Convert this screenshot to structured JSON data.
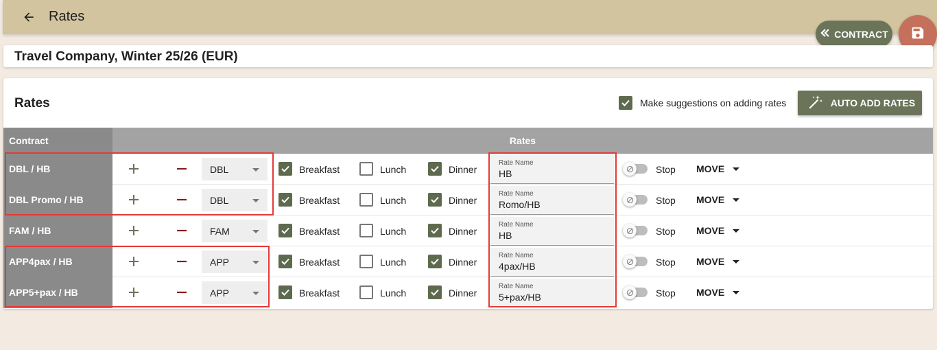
{
  "topbar": {
    "title": "Rates"
  },
  "actions": {
    "contract_label": "CONTRACT"
  },
  "header": {
    "title": "Travel Company, Winter 25/26 (EUR)"
  },
  "rates_section": {
    "title": "Rates",
    "suggestions_label": "Make suggestions on adding rates",
    "suggestions_checked": true,
    "auto_add_label": "AUTO ADD RATES",
    "col_contract": "Contract",
    "col_rates": "Rates"
  },
  "meals": {
    "breakfast": "Breakfast",
    "lunch": "Lunch",
    "dinner": "Dinner"
  },
  "rows": [
    {
      "contract": "DBL / HB",
      "room_type": "DBL",
      "breakfast": true,
      "lunch": false,
      "dinner": true,
      "rate_name_label": "Rate Name",
      "rate_name": "HB",
      "stop_label": "Stop",
      "stop": false,
      "move_label": "MOVE"
    },
    {
      "contract": "DBL Promo / HB",
      "room_type": "DBL",
      "breakfast": true,
      "lunch": false,
      "dinner": true,
      "rate_name_label": "Rate Name",
      "rate_name": "Romo/HB",
      "stop_label": "Stop",
      "stop": false,
      "move_label": "MOVE"
    },
    {
      "contract": "FAM / HB",
      "room_type": "FAM",
      "breakfast": true,
      "lunch": false,
      "dinner": true,
      "rate_name_label": "Rate Name",
      "rate_name": "HB",
      "stop_label": "Stop",
      "stop": false,
      "move_label": "MOVE"
    },
    {
      "contract": "APP4pax / HB",
      "room_type": "APP",
      "breakfast": true,
      "lunch": false,
      "dinner": true,
      "rate_name_label": "Rate Name",
      "rate_name": "4pax/HB",
      "stop_label": "Stop",
      "stop": false,
      "move_label": "MOVE"
    },
    {
      "contract": "APP5+pax / HB",
      "room_type": "APP",
      "breakfast": true,
      "lunch": false,
      "dinner": true,
      "rate_name_label": "Rate Name",
      "rate_name": "5+pax/HB",
      "stop_label": "Stop",
      "stop": false,
      "move_label": "MOVE"
    }
  ],
  "colors": {
    "accent": "#6b7358",
    "save": "#c4705c",
    "topbar": "#d3c4a0",
    "highlight": "#e53935",
    "checkbox": "#5e6a4e"
  }
}
